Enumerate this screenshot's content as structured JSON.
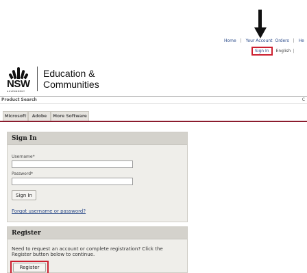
{
  "annotation": {
    "arrow": "down-arrow-icon",
    "highlight_color": "#cc1f2f"
  },
  "header": {
    "links": {
      "home": "Home",
      "sep": "|",
      "your_account": "Your Account",
      "orders": "Orders",
      "help": "He"
    },
    "sign_in_link": "Sign In",
    "language": "English",
    "lang_sep": "|"
  },
  "logo": {
    "nsw": "NSW",
    "government": "GOVERNMENT",
    "line1": "Education &",
    "line2": "Communities"
  },
  "search_bar": {
    "label": "Product Search",
    "right_text": "C"
  },
  "tabs": [
    {
      "label": "Microsoft"
    },
    {
      "label": "Adobe"
    },
    {
      "label": "More Software"
    }
  ],
  "signin_panel": {
    "title": "Sign In",
    "username_label": "Username*",
    "username_value": "",
    "password_label": "Password*",
    "password_value": "",
    "button": "Sign In",
    "forgot_link": "Forgot username or password?"
  },
  "register_panel": {
    "title": "Register",
    "text": "Need to request an account or complete registration? Click the Register button below to continue.",
    "button": "Register"
  }
}
